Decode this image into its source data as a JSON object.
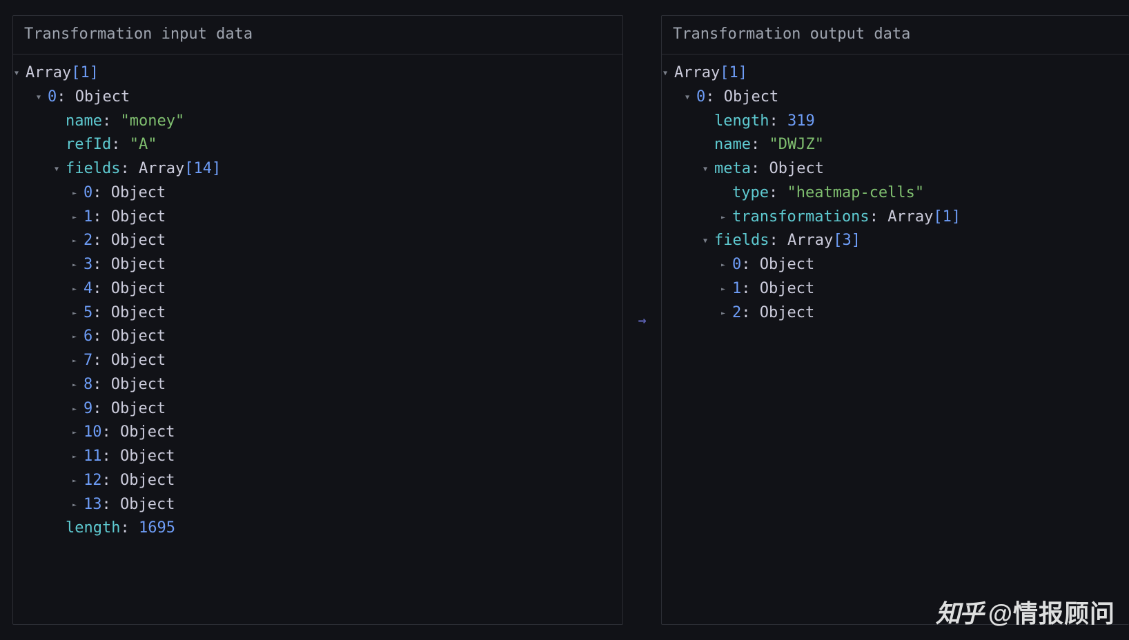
{
  "left": {
    "title": "Transformation input data",
    "root": {
      "label": "Array",
      "count": "[1]"
    },
    "item0": {
      "idx": "0",
      "type": "Object"
    },
    "name": {
      "key": "name",
      "value": "\"money\""
    },
    "refId": {
      "key": "refId",
      "value": "\"A\""
    },
    "fields": {
      "key": "fields",
      "label": "Array",
      "count": "[14]"
    },
    "fieldItems": [
      {
        "idx": "0",
        "type": "Object"
      },
      {
        "idx": "1",
        "type": "Object"
      },
      {
        "idx": "2",
        "type": "Object"
      },
      {
        "idx": "3",
        "type": "Object"
      },
      {
        "idx": "4",
        "type": "Object"
      },
      {
        "idx": "5",
        "type": "Object"
      },
      {
        "idx": "6",
        "type": "Object"
      },
      {
        "idx": "7",
        "type": "Object"
      },
      {
        "idx": "8",
        "type": "Object"
      },
      {
        "idx": "9",
        "type": "Object"
      },
      {
        "idx": "10",
        "type": "Object"
      },
      {
        "idx": "11",
        "type": "Object"
      },
      {
        "idx": "12",
        "type": "Object"
      },
      {
        "idx": "13",
        "type": "Object"
      }
    ],
    "length": {
      "key": "length",
      "value": "1695"
    }
  },
  "right": {
    "title": "Transformation output data",
    "root": {
      "label": "Array",
      "count": "[1]"
    },
    "item0": {
      "idx": "0",
      "type": "Object"
    },
    "length": {
      "key": "length",
      "value": "319"
    },
    "name": {
      "key": "name",
      "value": "\"DWJZ\""
    },
    "meta": {
      "key": "meta",
      "type": "Object"
    },
    "metaType": {
      "key": "type",
      "value": "\"heatmap-cells\""
    },
    "transformations": {
      "key": "transformations",
      "label": "Array",
      "count": "[1]"
    },
    "fields": {
      "key": "fields",
      "label": "Array",
      "count": "[3]"
    },
    "fieldItems": [
      {
        "idx": "0",
        "type": "Object"
      },
      {
        "idx": "1",
        "type": "Object"
      },
      {
        "idx": "2",
        "type": "Object"
      }
    ]
  },
  "watermark": {
    "logo": "知乎",
    "text": "@情报顾问"
  }
}
